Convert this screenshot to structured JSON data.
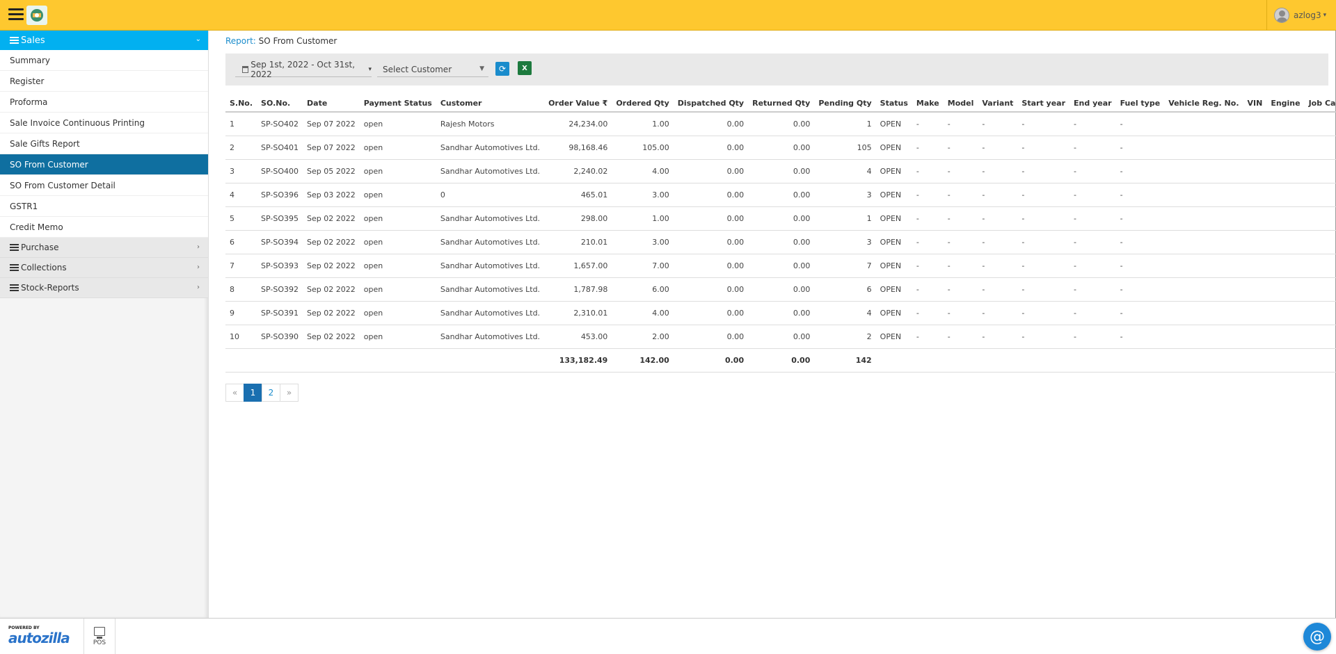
{
  "header": {
    "username": "azlog3"
  },
  "sidebar": {
    "section": "Sales",
    "items": [
      {
        "label": "Summary"
      },
      {
        "label": "Register"
      },
      {
        "label": "Proforma"
      },
      {
        "label": "Sale Invoice Continuous Printing"
      },
      {
        "label": "Sale Gifts Report"
      },
      {
        "label": "SO From Customer"
      },
      {
        "label": "SO From Customer Detail"
      },
      {
        "label": "GSTR1"
      },
      {
        "label": "Credit Memo"
      }
    ],
    "groups": [
      {
        "label": "Purchase"
      },
      {
        "label": "Collections"
      },
      {
        "label": "Stock-Reports"
      }
    ]
  },
  "breadcrumb": {
    "link": "Report:",
    "current": "SO From Customer"
  },
  "filters": {
    "date_range": "Sep 1st, 2022 - Oct 31st, 2022",
    "customer_placeholder": "Select Customer",
    "excel_icon_text": "X"
  },
  "table": {
    "headers": [
      "S.No.",
      "SO.No.",
      "Date",
      "Payment Status",
      "Customer",
      "Order Value ₹",
      "Ordered Qty",
      "Dispatched Qty",
      "Returned Qty",
      "Pending Qty",
      "Status",
      "Make",
      "Model",
      "Variant",
      "Start year",
      "End year",
      "Fuel type",
      "Vehicle Reg. No.",
      "VIN",
      "Engine",
      "Job Card"
    ],
    "rows": [
      [
        "1",
        "SP-SO402",
        "Sep 07 2022",
        "open",
        "Rajesh Motors",
        "24,234.00",
        "1.00",
        "0.00",
        "0.00",
        "1",
        "OPEN",
        "-",
        "-",
        "-",
        "-",
        "-",
        "-",
        "",
        "",
        "",
        ""
      ],
      [
        "2",
        "SP-SO401",
        "Sep 07 2022",
        "open",
        "Sandhar Automotives Ltd.",
        "98,168.46",
        "105.00",
        "0.00",
        "0.00",
        "105",
        "OPEN",
        "-",
        "-",
        "-",
        "-",
        "-",
        "-",
        "",
        "",
        "",
        ""
      ],
      [
        "3",
        "SP-SO400",
        "Sep 05 2022",
        "open",
        "Sandhar Automotives Ltd.",
        "2,240.02",
        "4.00",
        "0.00",
        "0.00",
        "4",
        "OPEN",
        "-",
        "-",
        "-",
        "-",
        "-",
        "-",
        "",
        "",
        "",
        ""
      ],
      [
        "4",
        "SP-SO396",
        "Sep 03 2022",
        "open",
        "0",
        "465.01",
        "3.00",
        "0.00",
        "0.00",
        "3",
        "OPEN",
        "-",
        "-",
        "-",
        "-",
        "-",
        "-",
        "",
        "",
        "",
        ""
      ],
      [
        "5",
        "SP-SO395",
        "Sep 02 2022",
        "open",
        "Sandhar Automotives Ltd.",
        "298.00",
        "1.00",
        "0.00",
        "0.00",
        "1",
        "OPEN",
        "-",
        "-",
        "-",
        "-",
        "-",
        "-",
        "",
        "",
        "",
        ""
      ],
      [
        "6",
        "SP-SO394",
        "Sep 02 2022",
        "open",
        "Sandhar Automotives Ltd.",
        "210.01",
        "3.00",
        "0.00",
        "0.00",
        "3",
        "OPEN",
        "-",
        "-",
        "-",
        "-",
        "-",
        "-",
        "",
        "",
        "",
        ""
      ],
      [
        "7",
        "SP-SO393",
        "Sep 02 2022",
        "open",
        "Sandhar Automotives Ltd.",
        "1,657.00",
        "7.00",
        "0.00",
        "0.00",
        "7",
        "OPEN",
        "-",
        "-",
        "-",
        "-",
        "-",
        "-",
        "",
        "",
        "",
        ""
      ],
      [
        "8",
        "SP-SO392",
        "Sep 02 2022",
        "open",
        "Sandhar Automotives Ltd.",
        "1,787.98",
        "6.00",
        "0.00",
        "0.00",
        "6",
        "OPEN",
        "-",
        "-",
        "-",
        "-",
        "-",
        "-",
        "",
        "",
        "",
        ""
      ],
      [
        "9",
        "SP-SO391",
        "Sep 02 2022",
        "open",
        "Sandhar Automotives Ltd.",
        "2,310.01",
        "4.00",
        "0.00",
        "0.00",
        "4",
        "OPEN",
        "-",
        "-",
        "-",
        "-",
        "-",
        "-",
        "",
        "",
        "",
        ""
      ],
      [
        "10",
        "SP-SO390",
        "Sep 02 2022",
        "open",
        "Sandhar Automotives Ltd.",
        "453.00",
        "2.00",
        "0.00",
        "0.00",
        "2",
        "OPEN",
        "-",
        "-",
        "-",
        "-",
        "-",
        "-",
        "",
        "",
        "",
        ""
      ]
    ],
    "totals": {
      "order_value": "133,182.49",
      "ordered_qty": "142.00",
      "dispatched_qty": "0.00",
      "returned_qty": "0.00",
      "pending_qty": "142"
    }
  },
  "pagination": {
    "prev": "«",
    "pages": [
      "1",
      "2"
    ],
    "next": "»",
    "current": "1"
  },
  "footer": {
    "powered_by": "POWERED BY",
    "brand": "autozilla",
    "pos_label": "POS"
  },
  "colors": {
    "topbar": "#fec82f",
    "sidebar_head": "#02b0f0",
    "active_item": "#0f6fa0",
    "link": "#1a8ccc"
  }
}
